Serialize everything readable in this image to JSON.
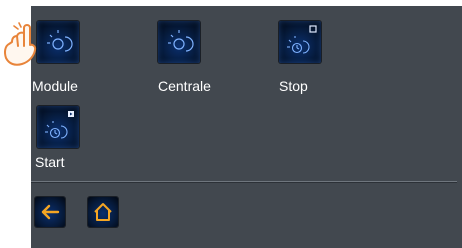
{
  "tiles": [
    {
      "label": "Module",
      "icon": "sun-moon-icon"
    },
    {
      "label": "Centrale",
      "icon": "sun-moon-icon"
    },
    {
      "label": "Stop",
      "icon": "sun-moon-timer-stop-icon"
    },
    {
      "label": "Start",
      "icon": "sun-moon-timer-start-icon"
    }
  ],
  "nav": {
    "back_icon": "arrow-left-icon",
    "home_icon": "home-icon"
  },
  "colors": {
    "panel": "#42484f",
    "icon_glow": "#3f8cff",
    "nav_accent": "#f5a623"
  }
}
